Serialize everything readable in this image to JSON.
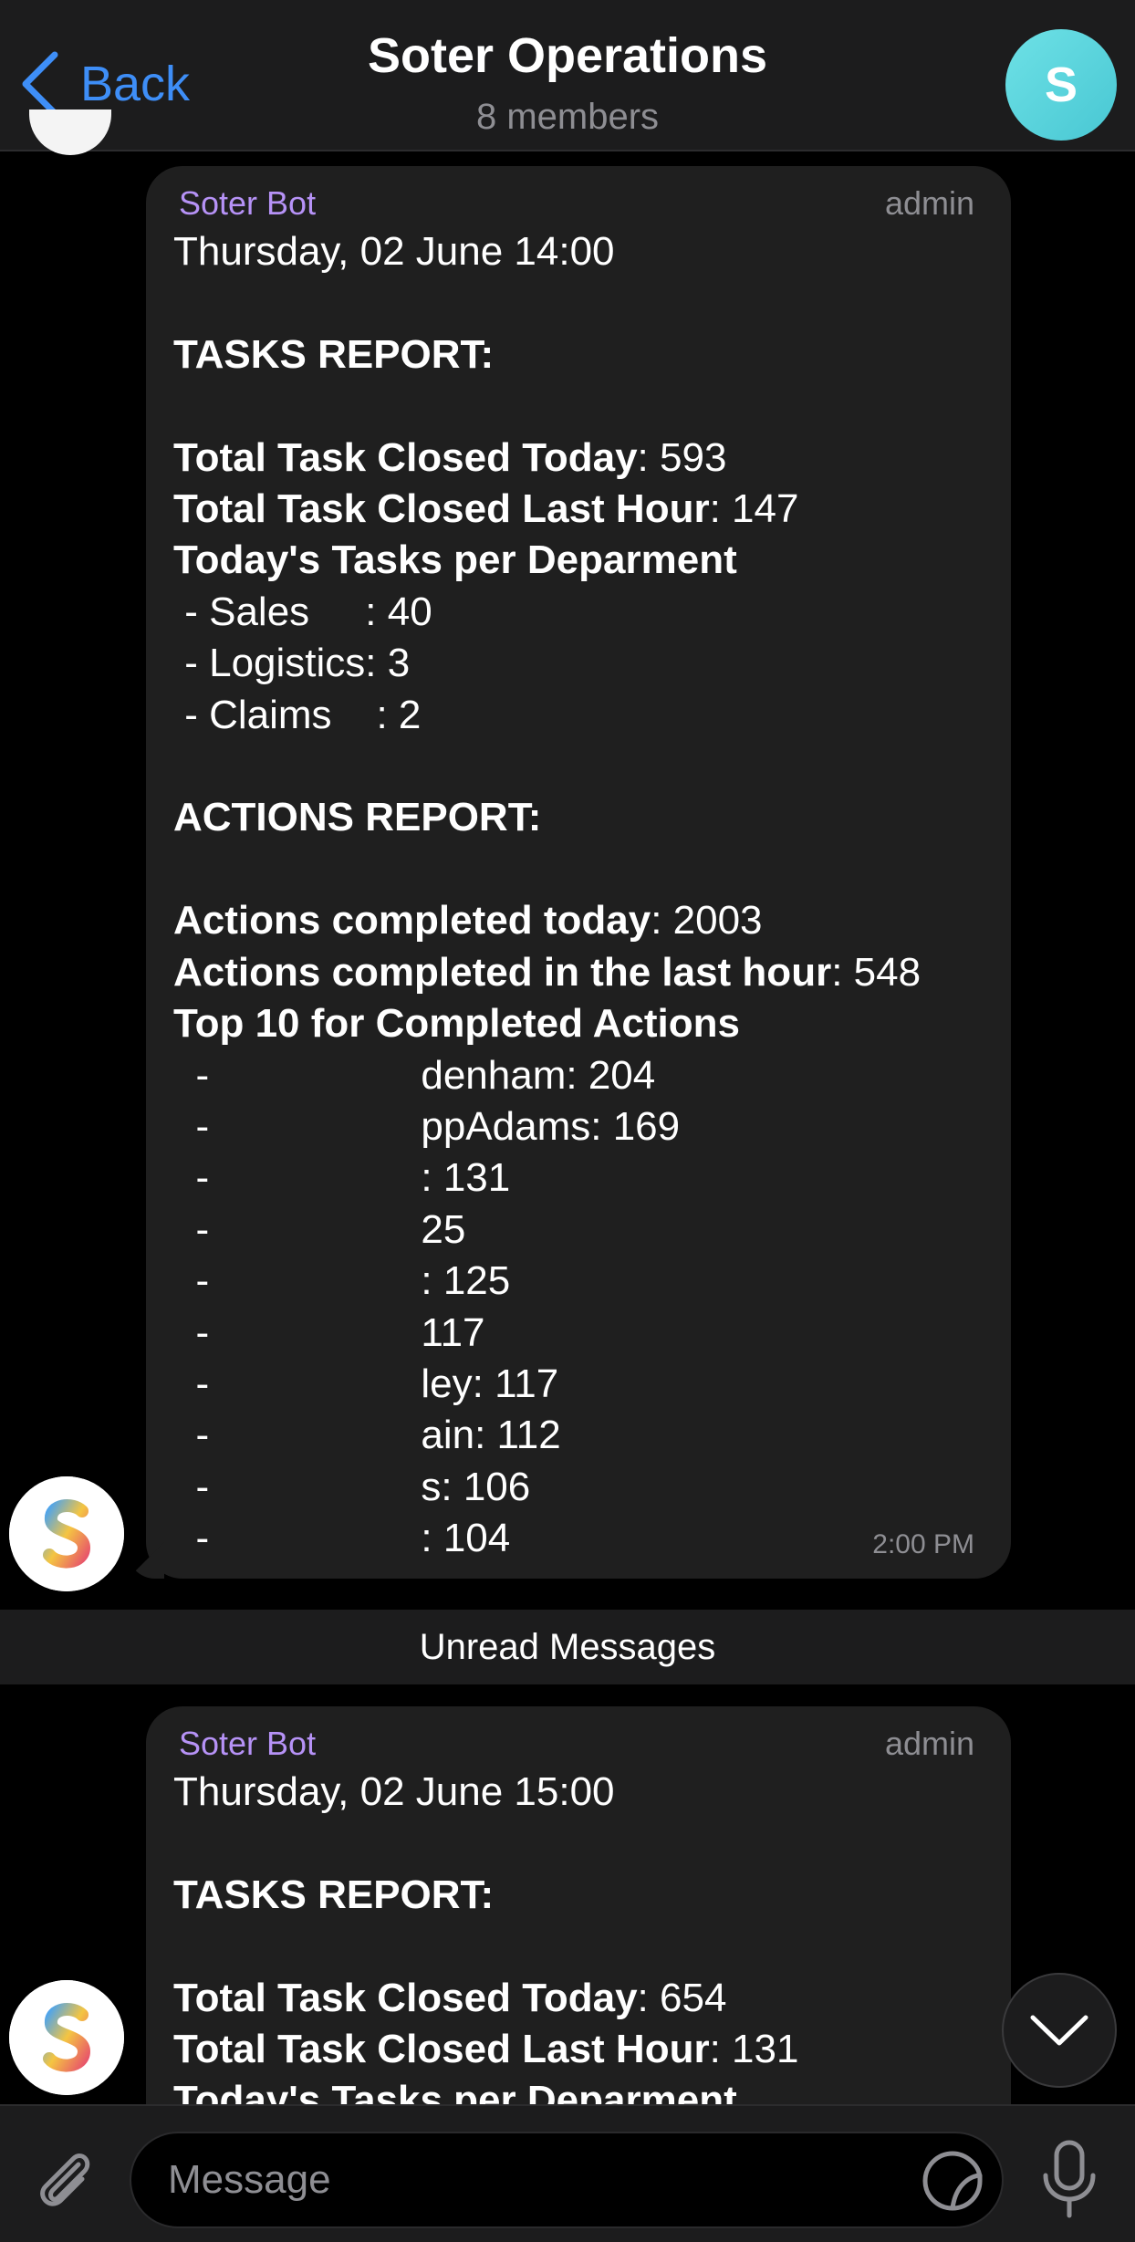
{
  "header": {
    "back_label": "Back",
    "title": "Soter Operations",
    "subtitle": "8 members",
    "avatar_letter": "S"
  },
  "messages": [
    {
      "sender": "Soter Bot",
      "role": "admin",
      "date_line": "Thursday, 02 June 14:00",
      "tasks_heading": "TASKS REPORT:",
      "total_today_label": "Total Task Closed Today",
      "total_today_value": ": 593",
      "last_hour_label": "Total Task Closed Last Hour",
      "last_hour_value": ": 147",
      "per_dept_label": "Today's Tasks per Deparment",
      "dept_lines": [
        " - Sales     : 40",
        " - Logistics: 3",
        " - Claims    : 2"
      ],
      "actions_heading": "ACTIONS REPORT:",
      "actions_today_label": "Actions completed today",
      "actions_today_value": ": 2003",
      "actions_hour_label": "Actions completed in the last hour",
      "actions_hour_value": ": 548",
      "top10_label": "Top 10 for Completed Actions",
      "top_lines": [
        "  -                   denham: 204",
        "  -                   ppAdams: 169",
        "  -                   : 131",
        "  -                   25",
        "  -                   : 125",
        "  -                   117",
        "  -                   ley: 117",
        "  -                   ain: 112",
        "  -                   s: 106",
        "  -                   : 104"
      ],
      "time": "2:00 PM"
    },
    {
      "sender": "Soter Bot",
      "role": "admin",
      "date_line": "Thursday, 02 June 15:00",
      "tasks_heading": "TASKS REPORT:",
      "total_today_label": "Total Task Closed Today",
      "total_today_value": ": 654",
      "last_hour_label": "Total Task Closed Last Hour",
      "last_hour_value": ": 131",
      "per_dept_label": "Today's Tasks per Deparment"
    }
  ],
  "divider": {
    "label": "Unread Messages"
  },
  "composer": {
    "placeholder": "Message"
  },
  "icons": {
    "back": "chevron-left-icon",
    "attach": "paperclip-icon",
    "sticker": "sticker-icon",
    "mic": "microphone-icon",
    "scroll": "chevron-down-icon"
  },
  "colors": {
    "accent": "#3e8ef7",
    "sender": "#b692f6",
    "bubble": "#1f1f1f",
    "header_avatar": "#5fd6de"
  }
}
